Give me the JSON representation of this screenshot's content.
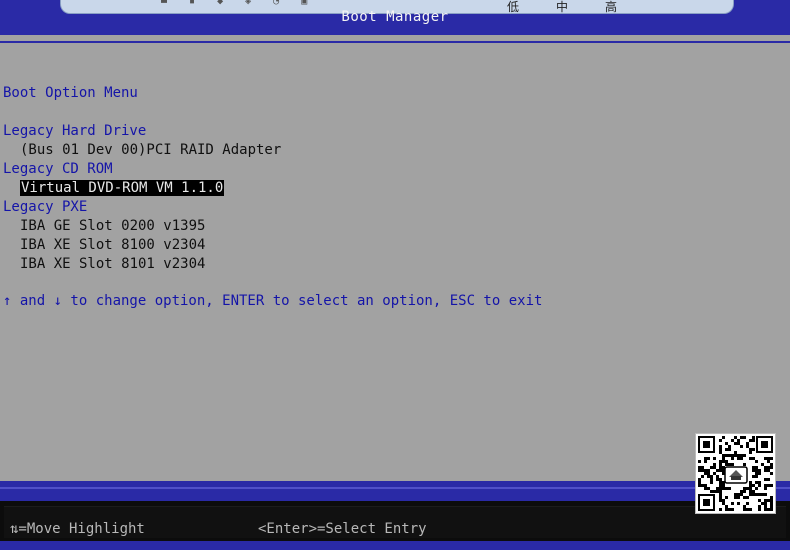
{
  "header": {
    "title": "Boot Manager"
  },
  "viewer_toolbar": {
    "zoom_levels": [
      "低",
      "中",
      "高"
    ]
  },
  "menu": {
    "title": "Boot Option Menu",
    "groups": [
      {
        "label": "Legacy Hard Drive",
        "items": [
          "(Bus 01 Dev 00)PCI RAID Adapter"
        ]
      },
      {
        "label": "Legacy CD ROM",
        "items": [
          "Virtual DVD-ROM VM 1.1.0"
        ]
      },
      {
        "label": "Legacy PXE",
        "items": [
          "IBA GE Slot 0200 v1395",
          "IBA XE Slot 8100 v2304",
          "IBA XE Slot 8101 v2304"
        ]
      }
    ],
    "selected_item": "Virtual DVD-ROM VM 1.1.0",
    "help_text": "↑ and ↓ to change option, ENTER to select an option, ESC to exit"
  },
  "footer": {
    "move_hint": "⇅=Move Highlight",
    "select_hint": "<Enter>=Select Entry"
  },
  "colors": {
    "header_band": "#2a2aa6",
    "background": "#a2a2a2",
    "menu_text": "#1414a8",
    "highlight_bg": "#000000"
  }
}
